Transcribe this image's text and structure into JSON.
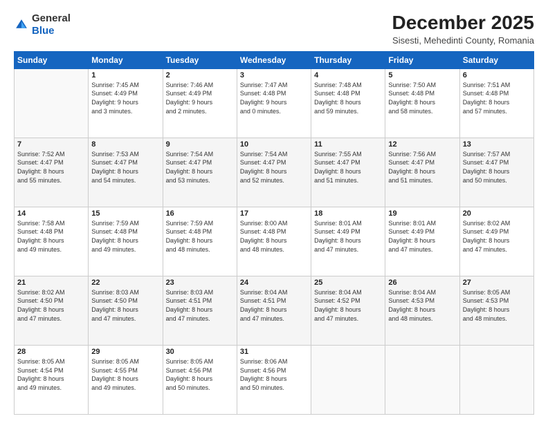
{
  "logo": {
    "general": "General",
    "blue": "Blue"
  },
  "header": {
    "month": "December 2025",
    "location": "Sisesti, Mehedinti County, Romania"
  },
  "weekdays": [
    "Sunday",
    "Monday",
    "Tuesday",
    "Wednesday",
    "Thursday",
    "Friday",
    "Saturday"
  ],
  "weeks": [
    [
      {
        "day": "",
        "info": ""
      },
      {
        "day": "1",
        "info": "Sunrise: 7:45 AM\nSunset: 4:49 PM\nDaylight: 9 hours\nand 3 minutes."
      },
      {
        "day": "2",
        "info": "Sunrise: 7:46 AM\nSunset: 4:49 PM\nDaylight: 9 hours\nand 2 minutes."
      },
      {
        "day": "3",
        "info": "Sunrise: 7:47 AM\nSunset: 4:48 PM\nDaylight: 9 hours\nand 0 minutes."
      },
      {
        "day": "4",
        "info": "Sunrise: 7:48 AM\nSunset: 4:48 PM\nDaylight: 8 hours\nand 59 minutes."
      },
      {
        "day": "5",
        "info": "Sunrise: 7:50 AM\nSunset: 4:48 PM\nDaylight: 8 hours\nand 58 minutes."
      },
      {
        "day": "6",
        "info": "Sunrise: 7:51 AM\nSunset: 4:48 PM\nDaylight: 8 hours\nand 57 minutes."
      }
    ],
    [
      {
        "day": "7",
        "info": "Sunrise: 7:52 AM\nSunset: 4:47 PM\nDaylight: 8 hours\nand 55 minutes."
      },
      {
        "day": "8",
        "info": "Sunrise: 7:53 AM\nSunset: 4:47 PM\nDaylight: 8 hours\nand 54 minutes."
      },
      {
        "day": "9",
        "info": "Sunrise: 7:54 AM\nSunset: 4:47 PM\nDaylight: 8 hours\nand 53 minutes."
      },
      {
        "day": "10",
        "info": "Sunrise: 7:54 AM\nSunset: 4:47 PM\nDaylight: 8 hours\nand 52 minutes."
      },
      {
        "day": "11",
        "info": "Sunrise: 7:55 AM\nSunset: 4:47 PM\nDaylight: 8 hours\nand 51 minutes."
      },
      {
        "day": "12",
        "info": "Sunrise: 7:56 AM\nSunset: 4:47 PM\nDaylight: 8 hours\nand 51 minutes."
      },
      {
        "day": "13",
        "info": "Sunrise: 7:57 AM\nSunset: 4:47 PM\nDaylight: 8 hours\nand 50 minutes."
      }
    ],
    [
      {
        "day": "14",
        "info": "Sunrise: 7:58 AM\nSunset: 4:48 PM\nDaylight: 8 hours\nand 49 minutes."
      },
      {
        "day": "15",
        "info": "Sunrise: 7:59 AM\nSunset: 4:48 PM\nDaylight: 8 hours\nand 49 minutes."
      },
      {
        "day": "16",
        "info": "Sunrise: 7:59 AM\nSunset: 4:48 PM\nDaylight: 8 hours\nand 48 minutes."
      },
      {
        "day": "17",
        "info": "Sunrise: 8:00 AM\nSunset: 4:48 PM\nDaylight: 8 hours\nand 48 minutes."
      },
      {
        "day": "18",
        "info": "Sunrise: 8:01 AM\nSunset: 4:49 PM\nDaylight: 8 hours\nand 47 minutes."
      },
      {
        "day": "19",
        "info": "Sunrise: 8:01 AM\nSunset: 4:49 PM\nDaylight: 8 hours\nand 47 minutes."
      },
      {
        "day": "20",
        "info": "Sunrise: 8:02 AM\nSunset: 4:49 PM\nDaylight: 8 hours\nand 47 minutes."
      }
    ],
    [
      {
        "day": "21",
        "info": "Sunrise: 8:02 AM\nSunset: 4:50 PM\nDaylight: 8 hours\nand 47 minutes."
      },
      {
        "day": "22",
        "info": "Sunrise: 8:03 AM\nSunset: 4:50 PM\nDaylight: 8 hours\nand 47 minutes."
      },
      {
        "day": "23",
        "info": "Sunrise: 8:03 AM\nSunset: 4:51 PM\nDaylight: 8 hours\nand 47 minutes."
      },
      {
        "day": "24",
        "info": "Sunrise: 8:04 AM\nSunset: 4:51 PM\nDaylight: 8 hours\nand 47 minutes."
      },
      {
        "day": "25",
        "info": "Sunrise: 8:04 AM\nSunset: 4:52 PM\nDaylight: 8 hours\nand 47 minutes."
      },
      {
        "day": "26",
        "info": "Sunrise: 8:04 AM\nSunset: 4:53 PM\nDaylight: 8 hours\nand 48 minutes."
      },
      {
        "day": "27",
        "info": "Sunrise: 8:05 AM\nSunset: 4:53 PM\nDaylight: 8 hours\nand 48 minutes."
      }
    ],
    [
      {
        "day": "28",
        "info": "Sunrise: 8:05 AM\nSunset: 4:54 PM\nDaylight: 8 hours\nand 49 minutes."
      },
      {
        "day": "29",
        "info": "Sunrise: 8:05 AM\nSunset: 4:55 PM\nDaylight: 8 hours\nand 49 minutes."
      },
      {
        "day": "30",
        "info": "Sunrise: 8:05 AM\nSunset: 4:56 PM\nDaylight: 8 hours\nand 50 minutes."
      },
      {
        "day": "31",
        "info": "Sunrise: 8:06 AM\nSunset: 4:56 PM\nDaylight: 8 hours\nand 50 minutes."
      },
      {
        "day": "",
        "info": ""
      },
      {
        "day": "",
        "info": ""
      },
      {
        "day": "",
        "info": ""
      }
    ]
  ]
}
